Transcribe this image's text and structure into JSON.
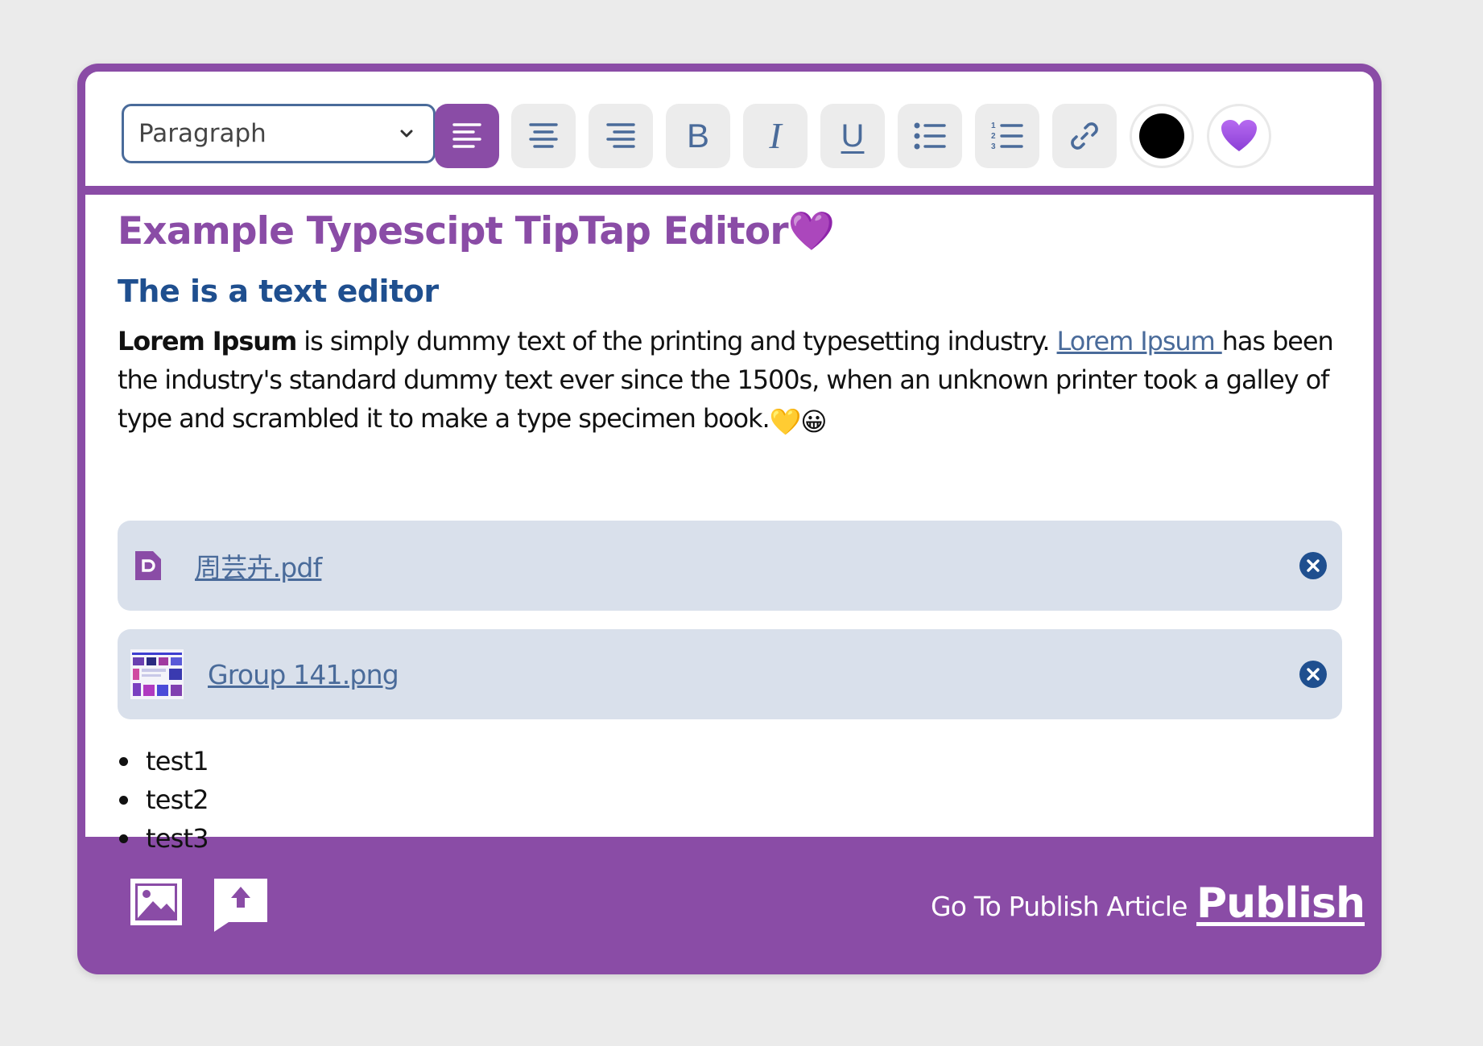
{
  "toolbar": {
    "block_type": "Paragraph",
    "buttons": {
      "align_left": "align-left",
      "align_center": "align-center",
      "align_right": "align-right",
      "bold": "B",
      "italic": "I",
      "underline": "U",
      "bullet_list": "bullet-list",
      "ordered_list": "ordered-list",
      "link": "link"
    },
    "text_color": "#000000",
    "highlight_emoji": "💜",
    "accent": "#8a4ca6"
  },
  "content": {
    "title": "Example Typescipt TipTap Editor",
    "title_emoji": "💜",
    "subtitle": "The is a text editor",
    "para_bold": "Lorem Ipsum",
    "para_part1": " is simply dummy text of the printing and typesetting industry. ",
    "para_link": "Lorem Ipsum ",
    "para_part2": "has been the industry's standard dummy text ever since the 1500s, when an unknown printer took a galley of type and scrambled it to make a type specimen book.",
    "para_emojis": "💛😀",
    "attachments": [
      {
        "name": "周芸卉.pdf",
        "kind": "pdf"
      },
      {
        "name": "Group 141.png",
        "kind": "image"
      }
    ],
    "list": [
      "test1",
      "test2",
      "test3"
    ]
  },
  "footer": {
    "go_to_publish": "Go To Publish Article",
    "publish": "Publish"
  }
}
